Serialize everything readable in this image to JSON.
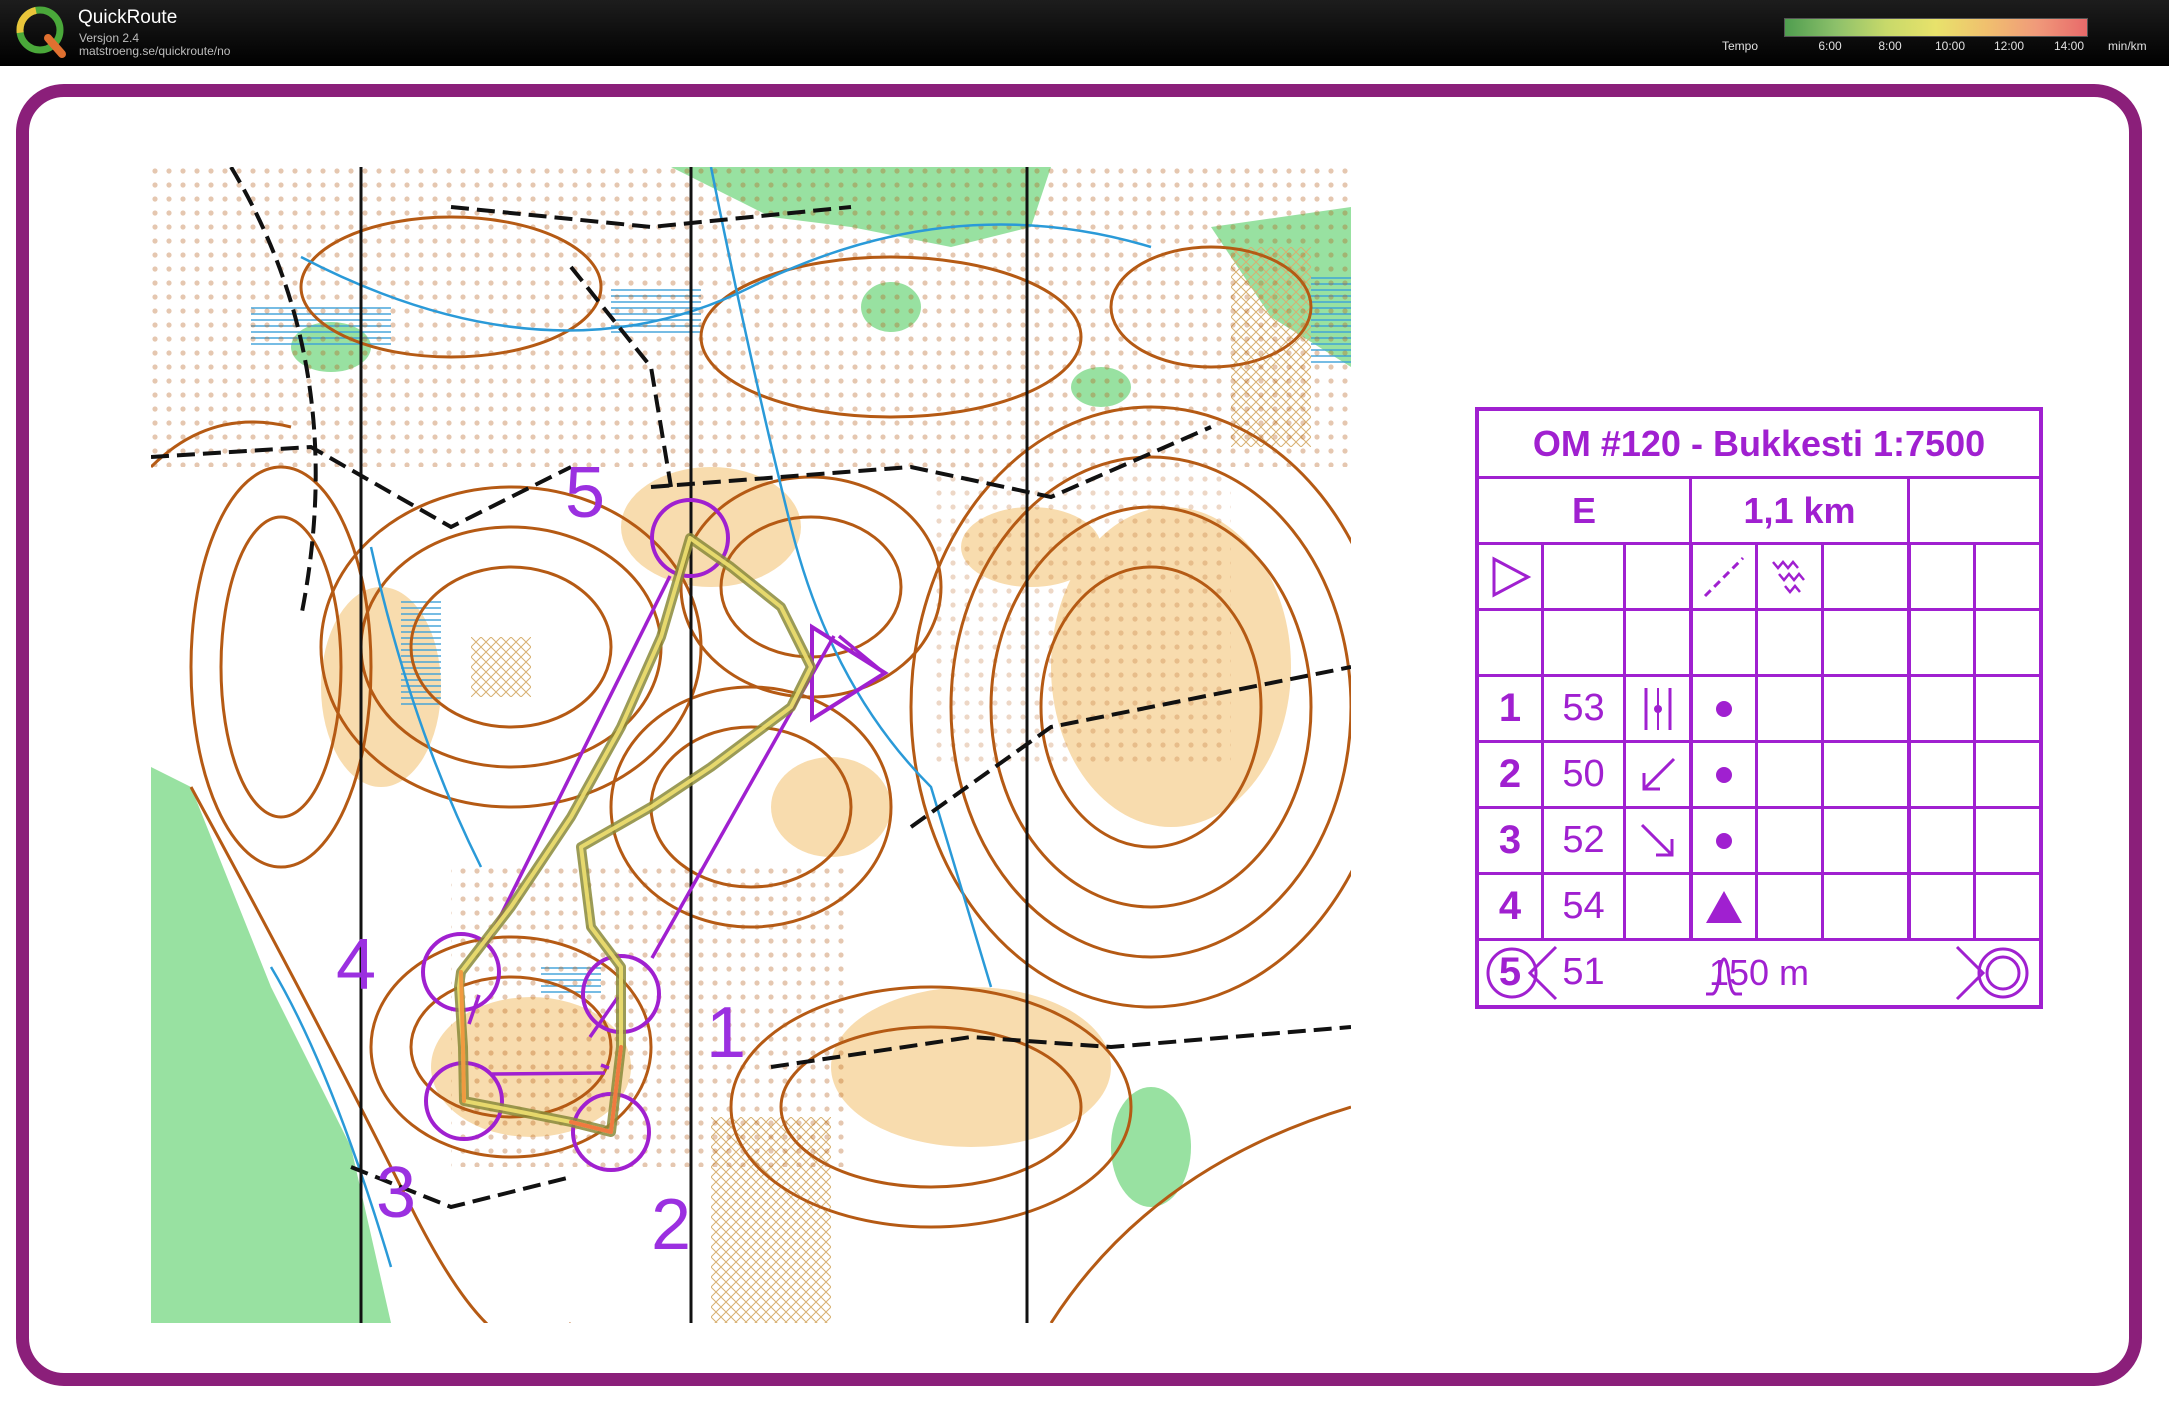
{
  "app": {
    "title": "QuickRoute",
    "version": "Versjon 2.4",
    "url": "matstroeng.se/quickroute/no",
    "logo_icon": "quickroute-logo-icon"
  },
  "tempo_legend": {
    "label": "Tempo",
    "ticks": [
      "6:00",
      "8:00",
      "10:00",
      "12:00",
      "14:00"
    ],
    "unit": "min/km",
    "colors": [
      "#4f9d4f",
      "#8cc06a",
      "#c7d96a",
      "#e8e26b",
      "#f0c06e",
      "#f09a7a",
      "#e86a6a"
    ]
  },
  "frame": {
    "color": "#8b1f7a"
  },
  "map": {
    "course_color": "#a020d0",
    "control_labels": [
      "5",
      "4",
      "1",
      "3",
      "2"
    ]
  },
  "description": {
    "title": "OM #120 - Bukkesti 1:7500",
    "class": "E",
    "length": "1,1 km",
    "controls": [
      {
        "num": "1",
        "code": "53",
        "symbol": "between-icon",
        "feature": "dot-icon"
      },
      {
        "num": "2",
        "code": "50",
        "symbol": "arrow-southwest-icon",
        "feature": "dot-icon"
      },
      {
        "num": "3",
        "code": "52",
        "symbol": "arrow-southeast-icon",
        "feature": "dot-icon"
      },
      {
        "num": "4",
        "code": "54",
        "symbol": "",
        "feature": "triangle-icon"
      },
      {
        "num": "5",
        "code": "51",
        "symbol": "",
        "feature": "knoll-icon"
      }
    ],
    "finish_distance": "150 m"
  }
}
